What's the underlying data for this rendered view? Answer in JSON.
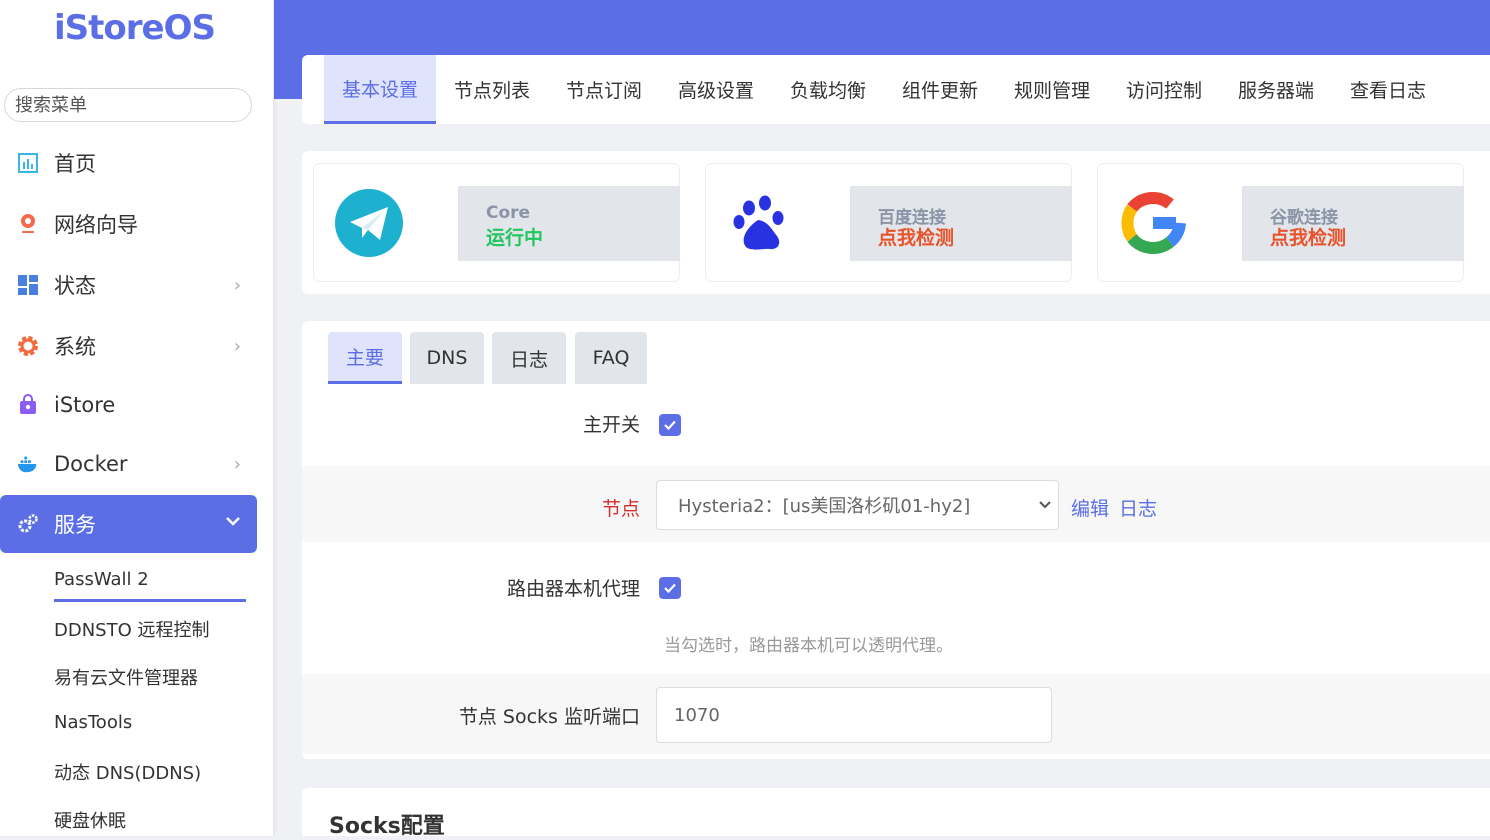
{
  "brand": {
    "logo": "iStoreOS"
  },
  "search": {
    "placeholder": "搜索菜单"
  },
  "sidebar": {
    "items": [
      {
        "label": "首页",
        "icon": "dashboard-icon"
      },
      {
        "label": "网络向导",
        "icon": "globe-pin-icon"
      },
      {
        "label": "状态",
        "icon": "grid-icon",
        "arrow": "›"
      },
      {
        "label": "系统",
        "icon": "gear-icon",
        "arrow": "›"
      },
      {
        "label": "iStore",
        "icon": "shopping-bag-icon"
      },
      {
        "label": "Docker",
        "icon": "docker-whale-icon",
        "arrow": "›"
      },
      {
        "label": "服务",
        "icon": "cogs-icon",
        "arrow": "⌄"
      }
    ],
    "subitems": [
      {
        "label": "PassWall 2"
      },
      {
        "label": "DDNSTO 远程控制"
      },
      {
        "label": "易有云文件管理器"
      },
      {
        "label": "NasTools"
      },
      {
        "label": "动态 DNS(DDNS)"
      },
      {
        "label": "硬盘休眠"
      }
    ]
  },
  "top_tabs": [
    {
      "label": "基本设置"
    },
    {
      "label": "节点列表"
    },
    {
      "label": "节点订阅"
    },
    {
      "label": "高级设置"
    },
    {
      "label": "负载均衡"
    },
    {
      "label": "组件更新"
    },
    {
      "label": "规则管理"
    },
    {
      "label": "访问控制"
    },
    {
      "label": "服务器端"
    },
    {
      "label": "查看日志"
    }
  ],
  "status": [
    {
      "label": "Core",
      "value": "运行中",
      "icon": "telegram-plane-icon"
    },
    {
      "label": "百度连接",
      "value": "点我检测",
      "icon": "baidu-paw-icon"
    },
    {
      "label": "谷歌连接",
      "value": "点我检测",
      "icon": "google-g-icon"
    }
  ],
  "sub_tabs": [
    {
      "label": "主要"
    },
    {
      "label": "DNS"
    },
    {
      "label": "日志"
    },
    {
      "label": "FAQ"
    }
  ],
  "form": {
    "main_switch_label": "主开关",
    "node_label": "节点",
    "node_value": "Hysteria2：[us美国洛杉矶01-hy2]",
    "edit_link": "编辑",
    "log_link": "日志",
    "router_proxy_label": "路由器本机代理",
    "router_proxy_hint": "当勾选时，路由器本机可以透明代理。",
    "socks_port_label": "节点 Socks 监听端口",
    "socks_port_value": "1070"
  },
  "socks_section": {
    "title": "Socks配置"
  },
  "colors": {
    "accent": "#5b6ee6",
    "running": "#22c55e",
    "check": "#e8532b"
  }
}
